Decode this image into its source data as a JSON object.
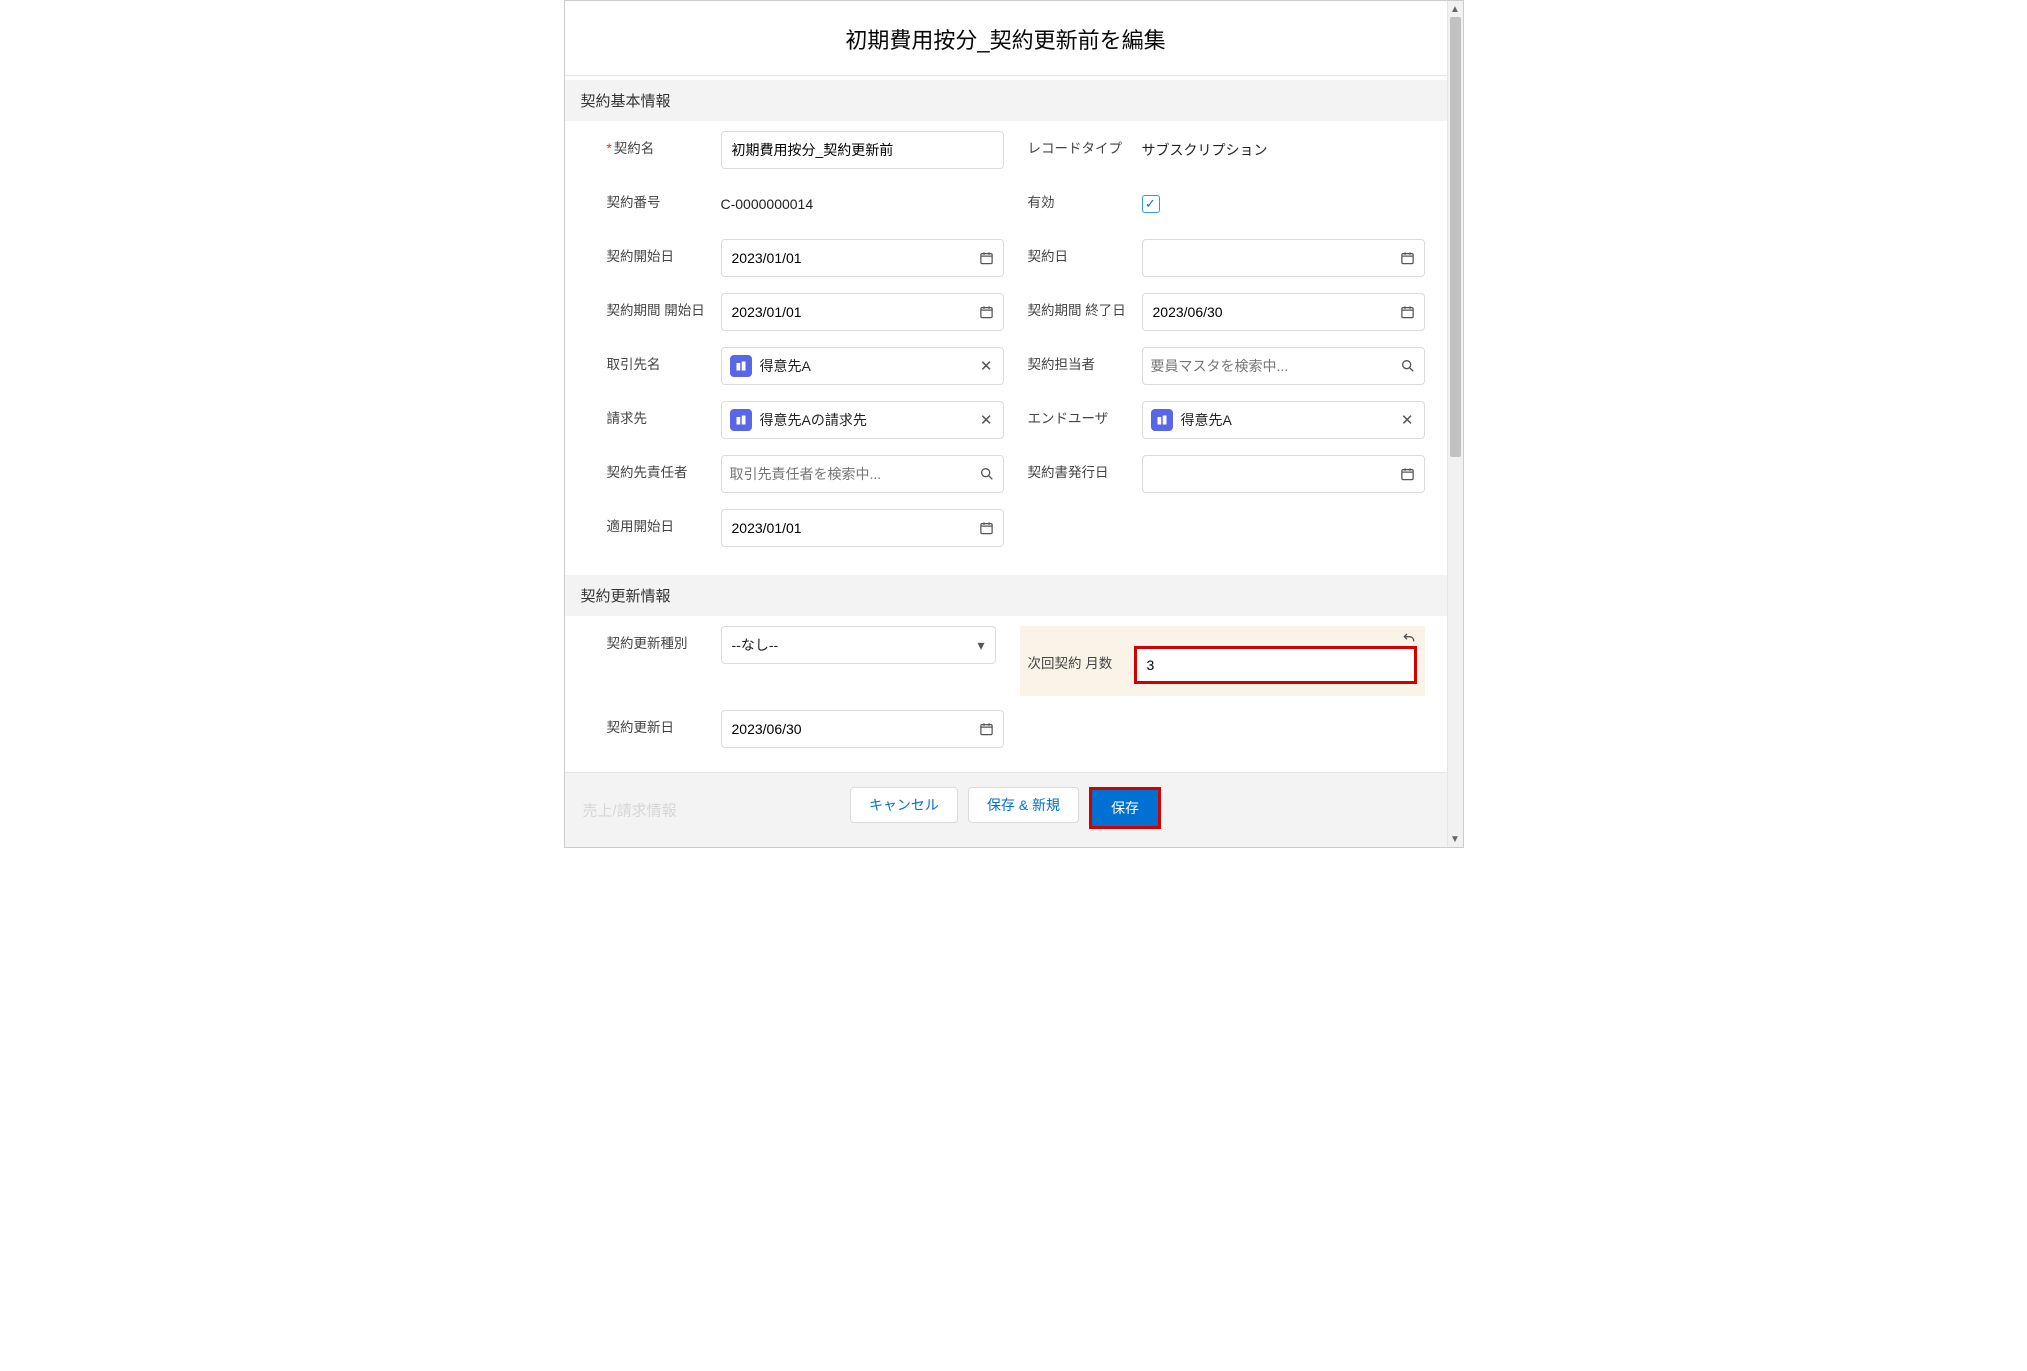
{
  "header": {
    "title": "初期費用按分_契約更新前を編集"
  },
  "sections": {
    "basic": "契約基本情報",
    "renewal": "契約更新情報"
  },
  "labels": {
    "contract_name": "契約名",
    "record_type": "レコードタイプ",
    "contract_number": "契約番号",
    "active": "有効",
    "start_date": "契約開始日",
    "contract_date": "契約日",
    "period_start": "契約期間 開始日",
    "period_end": "契約期間 終了日",
    "account_name": "取引先名",
    "owner": "契約担当者",
    "bill_to": "請求先",
    "end_user": "エンドユーザ",
    "account_resp": "契約先責任者",
    "issue_date": "契約書発行日",
    "apply_start": "適用開始日",
    "renew_type": "契約更新種別",
    "next_months": "次回契約 月数",
    "renew_date": "契約更新日"
  },
  "values": {
    "contract_name": "初期費用按分_契約更新前",
    "record_type": "サブスクリプション",
    "contract_number": "C-0000000014",
    "start_date": "2023/01/01",
    "contract_date": "",
    "period_start": "2023/01/01",
    "period_end": "2023/06/30",
    "account_name": "得意先A",
    "bill_to": "得意先Aの請求先",
    "end_user": "得意先A",
    "issue_date": "",
    "apply_start": "2023/01/01",
    "renew_type": "--なし--",
    "next_months": "3",
    "renew_date": "2023/06/30"
  },
  "placeholders": {
    "owner": "要員マスタを検索中...",
    "account_resp": "取引先責任者を検索中..."
  },
  "footer": {
    "disabled_hint": "売上/請求情報",
    "cancel": "キャンセル",
    "save_new": "保存 & 新規",
    "save": "保存"
  }
}
